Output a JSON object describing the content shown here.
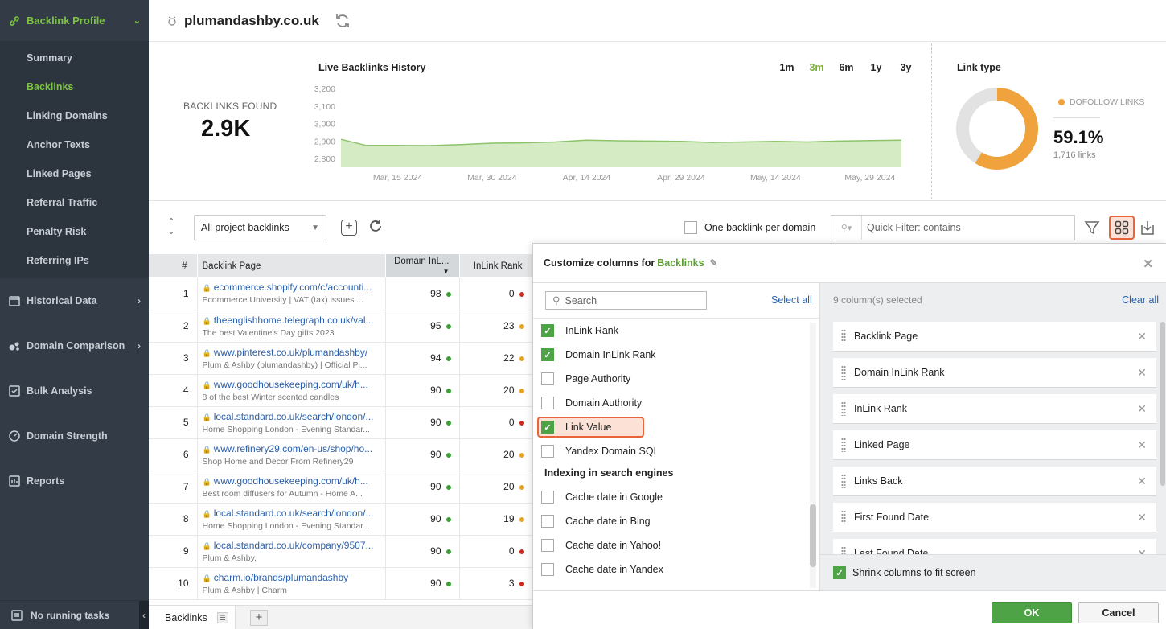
{
  "sidebar": {
    "header": "Backlink Profile",
    "subitems": [
      "Summary",
      "Backlinks",
      "Linking Domains",
      "Anchor Texts",
      "Linked Pages",
      "Referral Traffic",
      "Penalty Risk",
      "Referring IPs"
    ],
    "active_subitem": "Backlinks",
    "groups": [
      "Historical Data",
      "Domain Comparison",
      "Bulk Analysis",
      "Domain Strength",
      "Reports"
    ],
    "footer": "No running tasks"
  },
  "topbar": {
    "domain": "plumandashby.co.uk"
  },
  "stats": {
    "backlinks_label": "BACKLINKS FOUND",
    "backlinks_value": "2.9K",
    "history_title": "Live Backlinks History",
    "ranges": [
      "1m",
      "3m",
      "6m",
      "1y",
      "3y"
    ],
    "active_range": "3m",
    "link_type_title": "Link type",
    "legend_label": "DOFOLLOW LINKS",
    "percent": "59.1%",
    "links": "1,716 links"
  },
  "chart_data": [
    {
      "type": "area",
      "title": "Live Backlinks History",
      "x": [
        "2024-03-06",
        "2024-03-10",
        "2024-03-15",
        "2024-03-20",
        "2024-03-25",
        "2024-03-30",
        "2024-04-04",
        "2024-04-09",
        "2024-04-14",
        "2024-04-19",
        "2024-04-24",
        "2024-04-29",
        "2024-05-04",
        "2024-05-09",
        "2024-05-14",
        "2024-05-19",
        "2024-05-24",
        "2024-05-29",
        "2024-06-03"
      ],
      "x_tick_labels": [
        "Mar, 15 2024",
        "Mar, 30 2024",
        "Apr, 14 2024",
        "Apr, 29 2024",
        "May, 14 2024",
        "May, 29 2024"
      ],
      "y_tick_labels": [
        "2,800",
        "2,900",
        "3,000",
        "3,100",
        "3,200"
      ],
      "values": [
        2910,
        2875,
        2875,
        2874,
        2880,
        2888,
        2890,
        2895,
        2905,
        2902,
        2900,
        2898,
        2892,
        2895,
        2898,
        2895,
        2900,
        2903,
        2905
      ],
      "ylim": [
        2750,
        3210
      ],
      "color": "#8cc36b",
      "fill": "#d4ebc4"
    },
    {
      "type": "pie",
      "title": "Link type",
      "categories": [
        "DOFOLLOW LINKS",
        "other"
      ],
      "values": [
        59.1,
        40.9
      ],
      "colors": [
        "#f0a23c",
        "#e2e2e2"
      ]
    }
  ],
  "toolbar": {
    "select_value": "All project backlinks",
    "one_per_domain": "One backlink per domain",
    "quick_filter_placeholder": "Quick Filter: contains"
  },
  "table": {
    "headers": [
      "#",
      "Backlink Page",
      "Domain InL...",
      "InLink Rank"
    ],
    "rows": [
      {
        "idx": "1",
        "url": "ecommerce.shopify.com/c/accounti...",
        "title": "Ecommerce University | VAT (tax) issues ...",
        "dir": "98",
        "ir": "0",
        "ir_color": "r"
      },
      {
        "idx": "2",
        "url": "theenglishhome.telegraph.co.uk/val...",
        "title": "The best Valentine's Day gifts 2023",
        "dir": "95",
        "ir": "23",
        "ir_color": "o"
      },
      {
        "idx": "3",
        "url": "www.pinterest.co.uk/plumandashby/",
        "title": "Plum & Ashby (plumandashby) | Official Pi...",
        "dir": "94",
        "ir": "22",
        "ir_color": "o"
      },
      {
        "idx": "4",
        "url": "www.goodhousekeeping.com/uk/h...",
        "title": "8 of the best Winter scented candles",
        "dir": "90",
        "ir": "20",
        "ir_color": "o"
      },
      {
        "idx": "5",
        "url": "local.standard.co.uk/search/london/...",
        "title": "Home Shopping London - Evening Standar...",
        "dir": "90",
        "ir": "0",
        "ir_color": "r"
      },
      {
        "idx": "6",
        "url": "www.refinery29.com/en-us/shop/ho...",
        "title": "Shop Home and Decor From Refinery29",
        "dir": "90",
        "ir": "20",
        "ir_color": "o"
      },
      {
        "idx": "7",
        "url": "www.goodhousekeeping.com/uk/h...",
        "title": "Best room diffusers for Autumn - Home A...",
        "dir": "90",
        "ir": "20",
        "ir_color": "o"
      },
      {
        "idx": "8",
        "url": "local.standard.co.uk/search/london/...",
        "title": "Home Shopping London - Evening Standar...",
        "dir": "90",
        "ir": "19",
        "ir_color": "o"
      },
      {
        "idx": "9",
        "url": "local.standard.co.uk/company/9507...",
        "title": "Plum & Ashby,",
        "dir": "90",
        "ir": "0",
        "ir_color": "r"
      },
      {
        "idx": "10",
        "url": "charm.io/brands/plumandashby",
        "title": "Plum & Ashby | Charm",
        "dir": "90",
        "ir": "3",
        "ir_color": "r"
      }
    ]
  },
  "bottom_tab": "Backlinks",
  "dialog": {
    "title": "Customize columns for",
    "title_accent": "Backlinks",
    "search_placeholder": "Search",
    "select_all": "Select all",
    "options": [
      {
        "label": "InLink Rank",
        "checked": true
      },
      {
        "label": "Domain InLink Rank",
        "checked": true
      },
      {
        "label": "Page Authority",
        "checked": false
      },
      {
        "label": "Domain Authority",
        "checked": false
      },
      {
        "label": "Link Value",
        "checked": true,
        "highlighted": true
      },
      {
        "label": "Yandex Domain SQI",
        "checked": false
      }
    ],
    "group_title": "Indexing in search engines",
    "group_options": [
      {
        "label": "Cache date in Google",
        "checked": false
      },
      {
        "label": "Cache date in Bing",
        "checked": false
      },
      {
        "label": "Cache date in Yahoo!",
        "checked": false
      },
      {
        "label": "Cache date in Yandex",
        "checked": false
      }
    ],
    "selected_count": "9 column(s) selected",
    "clear_all": "Clear all",
    "selected": [
      "Backlink Page",
      "Domain InLink Rank",
      "InLink Rank",
      "Linked Page",
      "Links Back",
      "First Found Date",
      "Last Found Date"
    ],
    "shrink_label": "Shrink columns to fit screen",
    "ok": "OK",
    "cancel": "Cancel"
  }
}
